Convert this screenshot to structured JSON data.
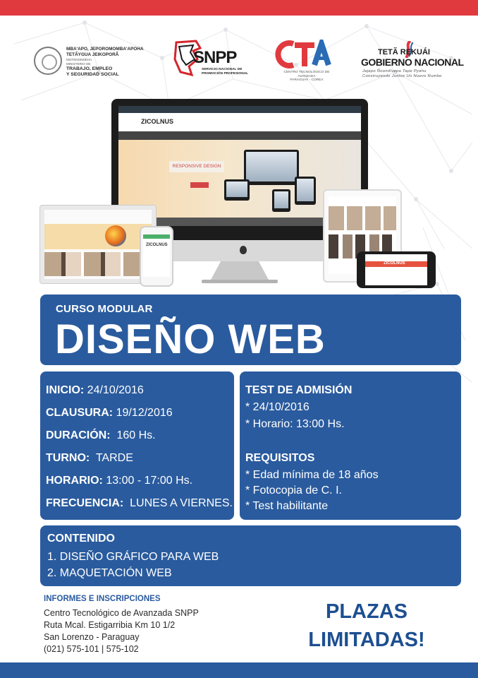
{
  "logos": {
    "gov": {
      "line1": "MBA'APO, JEPOROMOMBA'APOHA",
      "line2": "TETÃYGUA JEIKOPORÃ",
      "line3": "MOTENONDEHA",
      "ministry1": "MINISTERIO DE",
      "ministry2": "TRABAJO, EMPLEO",
      "ministry3": "Y SEGURIDAD SOCIAL"
    },
    "snpp": {
      "name": "SNPP",
      "sub1": "SERVICIO NACIONAL DE",
      "sub2": "PROMOCIÓN PROFESIONAL"
    },
    "ctf": {
      "sub1": "CENTRO TECNOLÓGICO DE AVANZADA",
      "sub2": "PARAGUAY - COREA"
    },
    "tetã": {
      "l1": "TETÃ REKUÁI",
      "l2": "GOBIERNO NACIONAL",
      "l3": "Jajapo Ñoondívepa Tape Pyahu",
      "l4": "Construyendo Juntos Un Nuevo Rumbo"
    }
  },
  "mockup": {
    "logo": "ZICOLNUS",
    "banner": "RESPONSIVE DESIGN"
  },
  "course": {
    "kicker": "CURSO MODULAR",
    "title": "DISEÑO WEB"
  },
  "details": [
    {
      "label": "INICIO:",
      "value": "24/10/2016"
    },
    {
      "label": "CLAUSURA:",
      "value": "19/12/2016"
    },
    {
      "label": "DURACIÓN:",
      "value": "160 Hs."
    },
    {
      "label": "TURNO:",
      "value": "TARDE"
    },
    {
      "label": "HORARIO:",
      "value": "13:00 - 17:00 Hs."
    },
    {
      "label": "FRECUENCIA:",
      "value": "LUNES A VIERNES."
    }
  ],
  "admission": {
    "title": "TEST DE ADMISIÓN",
    "items": [
      "* 24/10/2016",
      "* Horario: 13:00 Hs."
    ]
  },
  "requirements": {
    "title": "REQUISITOS",
    "items": [
      "* Edad mínima de 18 años",
      "* Fotocopia de C. I.",
      "* Test habilitante"
    ]
  },
  "content": {
    "title": "CONTENIDO",
    "items": [
      "1. DISEÑO GRÁFICO PARA WEB",
      "2. MAQUETACIÓN WEB"
    ]
  },
  "info": {
    "title": "INFORMES E INSCRIPCIONES",
    "lines": [
      "Centro Tecnológico de Avanzada SNPP",
      "Ruta Mcal. Estigarribia Km 10 1/2",
      "San Lorenzo - Paraguay",
      "(021) 575-101 |  575-102"
    ]
  },
  "cta": {
    "line1": "PLAZAS",
    "line2": "LIMITADAS!"
  },
  "colors": {
    "red": "#e03a3f",
    "blue": "#2a5b9e",
    "dark_blue": "#1d4f91"
  }
}
